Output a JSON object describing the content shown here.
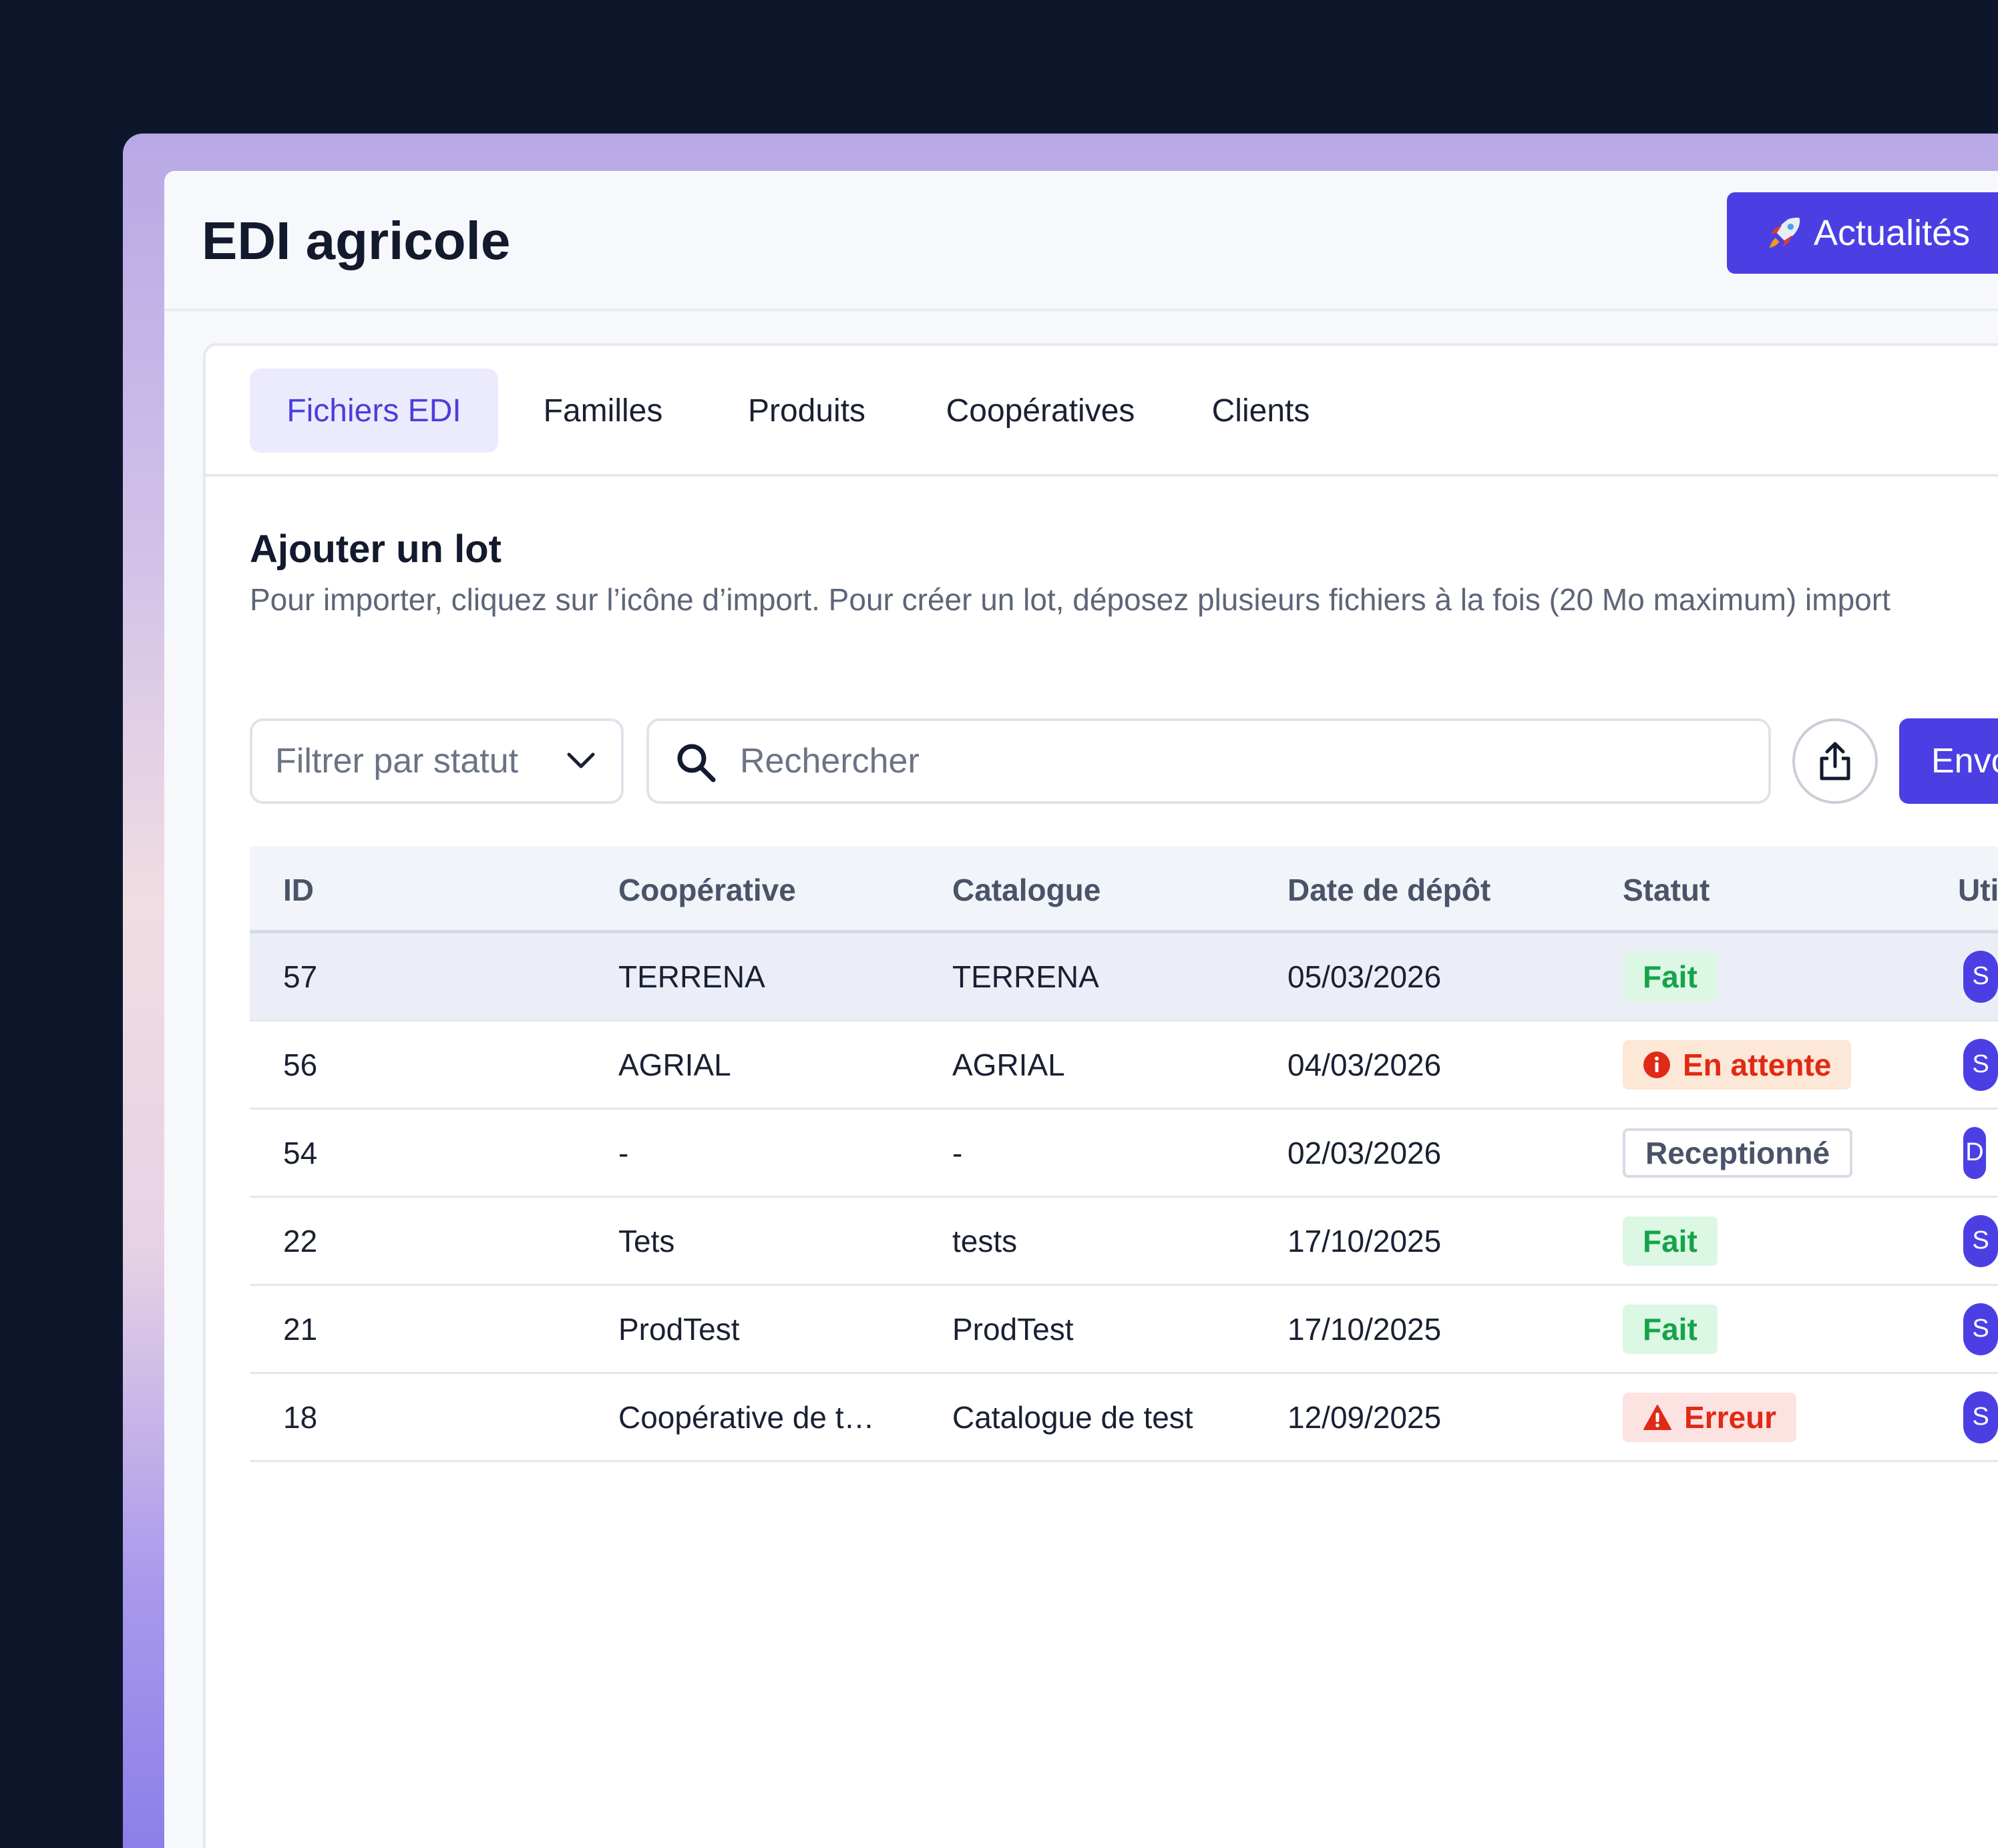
{
  "header": {
    "title": "EDI agricole",
    "news_button": "Actualités",
    "news_icon": "rocket-icon"
  },
  "tabs": [
    {
      "label": "Fichiers EDI",
      "active": true
    },
    {
      "label": "Familles",
      "active": false
    },
    {
      "label": "Produits",
      "active": false
    },
    {
      "label": "Coopératives",
      "active": false
    },
    {
      "label": "Clients",
      "active": false
    }
  ],
  "section": {
    "title": "Ajouter un lot",
    "description": "Pour importer, cliquez sur l’icône d’import. Pour créer un lot, déposez plusieurs fichiers à la fois (20 Mo maximum) import"
  },
  "toolbar": {
    "filter_placeholder": "Filtrer par statut",
    "search_placeholder": "Rechercher",
    "send_button": "Envo"
  },
  "table": {
    "columns": [
      "ID",
      "Coopérative",
      "Catalogue",
      "Date de dépôt",
      "Statut",
      "Util"
    ],
    "rows": [
      {
        "id": "57",
        "cooperative": "TERRENA",
        "catalogue": "TERRENA",
        "date": "05/03/2026",
        "status": "Fait",
        "status_kind": "done",
        "user": "S"
      },
      {
        "id": "56",
        "cooperative": "AGRIAL",
        "catalogue": "AGRIAL",
        "date": "04/03/2026",
        "status": "En attente",
        "status_kind": "pending",
        "user": "S"
      },
      {
        "id": "54",
        "cooperative": "-",
        "catalogue": "-",
        "date": "02/03/2026",
        "status": "Receptionné",
        "status_kind": "received",
        "user": "D"
      },
      {
        "id": "22",
        "cooperative": "Tets",
        "catalogue": "tests",
        "date": "17/10/2025",
        "status": "Fait",
        "status_kind": "done",
        "user": "S"
      },
      {
        "id": "21",
        "cooperative": "ProdTest",
        "catalogue": "ProdTest",
        "date": "17/10/2025",
        "status": "Fait",
        "status_kind": "done",
        "user": "S"
      },
      {
        "id": "18",
        "cooperative": "Coopérative de t…",
        "catalogue": "Catalogue de test",
        "date": "12/09/2025",
        "status": "Erreur",
        "status_kind": "error",
        "user": "S"
      }
    ]
  },
  "colors": {
    "accent": "#4b3fe4",
    "done": "#16a34a",
    "error": "#e02a16"
  }
}
